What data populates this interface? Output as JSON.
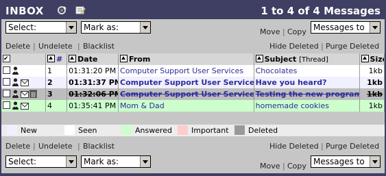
{
  "header": {
    "title": "INBOX",
    "count_label": "1 to 4 of 4 Messages"
  },
  "toolbar": {
    "select_value": "Select:",
    "mark_value": "Mark as:",
    "move_label": "Move",
    "copy_label": "Copy",
    "folder_value": "Messages to"
  },
  "actions": {
    "delete": "Delete",
    "undelete": "Undelete",
    "blacklist": "Blacklist",
    "hide_deleted": "Hide Deleted",
    "purge_deleted": "Purge Deleted"
  },
  "columns": {
    "num": "#",
    "date": "Date",
    "from": "From",
    "subject": "Subject",
    "thread": "[Thread]",
    "size": "Size"
  },
  "messages": [
    {
      "num": "1",
      "date": "01:31:20 PM",
      "from": "Computer Support User Services",
      "subject": "Chocolates",
      "size": "1kb",
      "status": "seen"
    },
    {
      "num": "2",
      "date": "01:31:37 PM",
      "from": "Computer Support User Services",
      "subject": "Have you heard?",
      "size": "1kb",
      "status": "new"
    },
    {
      "num": "3",
      "date": "01:32:06 PM",
      "from": "Computer Support User Services",
      "subject": "Testing the new program.",
      "size": "1kb",
      "status": "deleted"
    },
    {
      "num": "4",
      "date": "01:35:41 PM",
      "from": "Mom & Dad",
      "subject": "homemade cookies",
      "size": "1kb",
      "status": "answered"
    }
  ],
  "legend": {
    "new": "New",
    "seen": "Seen",
    "answered": "Answered",
    "important": "Important",
    "deleted": "Deleted"
  },
  "colors": {
    "title_bar": "#3f3f63",
    "new": "#f0f0ff",
    "seen": "#ffffff",
    "answered": "#ccffcc",
    "important": "#ffcccc",
    "deleted": "#999999",
    "link": "#2c2c9a"
  },
  "icons": {
    "header_left": "refresh-icon",
    "header_right": "compose-icon",
    "row_person": "person-icon",
    "row_envelope": "envelope-icon",
    "row_trash": "trash-icon"
  }
}
